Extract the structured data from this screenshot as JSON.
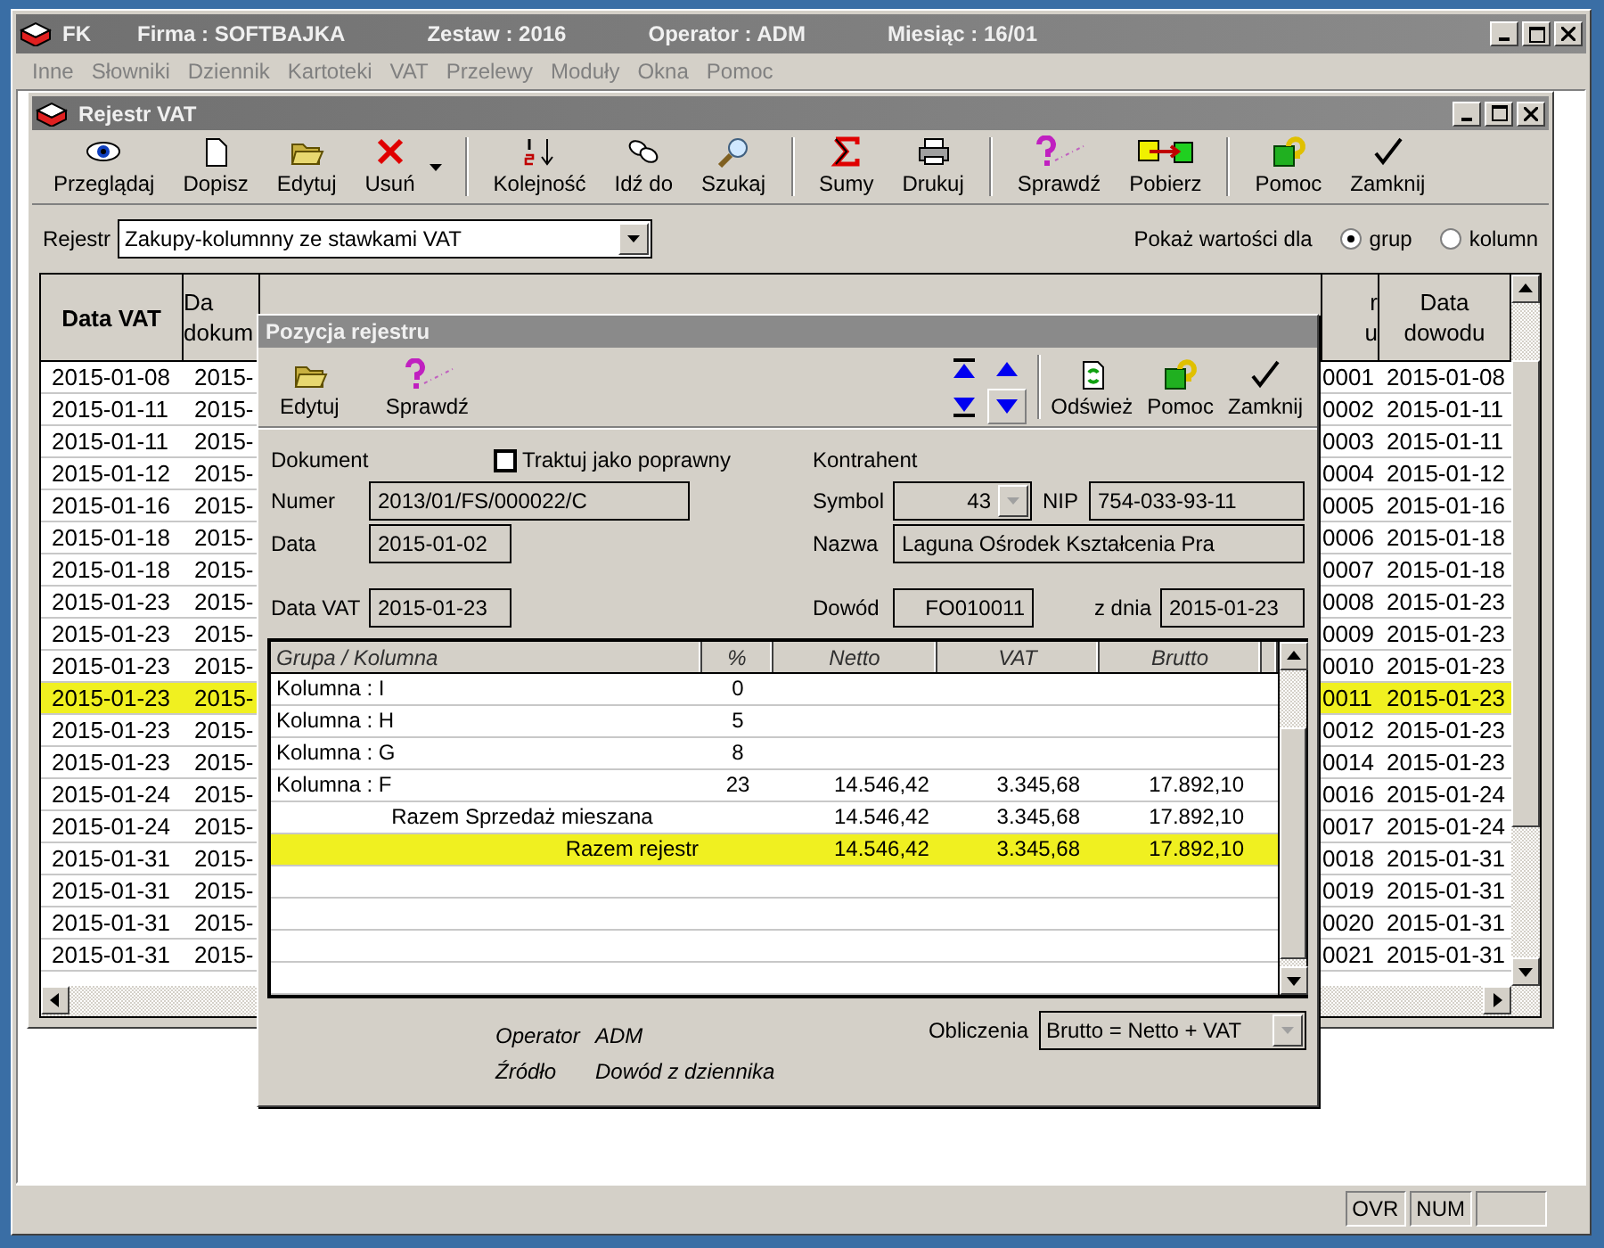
{
  "app": {
    "title": "FK",
    "title_fields": [
      "Firma : SOFTBAJKA",
      "Zestaw : 2016",
      "Operator : ADM",
      "Miesiąc : 16/01"
    ]
  },
  "menu": [
    {
      "label": "Inne",
      "disabled": true
    },
    {
      "label": "Słowniki",
      "disabled": true
    },
    {
      "label": "Dziennik",
      "disabled": true
    },
    {
      "label": "Kartoteki",
      "disabled": true
    },
    {
      "label": "VAT",
      "disabled": true
    },
    {
      "label": "Przelewy",
      "disabled": true
    },
    {
      "label": "Moduły",
      "disabled": true
    },
    {
      "label": "Okna",
      "disabled": true
    },
    {
      "label": "Pomoc",
      "disabled": true
    }
  ],
  "register_window": {
    "title": "Rejestr VAT",
    "toolbar": [
      {
        "kind": "button",
        "label": "Przeglądaj"
      },
      {
        "kind": "button",
        "label": "Dopisz"
      },
      {
        "kind": "button",
        "label": "Edytuj"
      },
      {
        "kind": "button",
        "label": "Usuń"
      },
      {
        "kind": "dropdown"
      },
      {
        "kind": "separator"
      },
      {
        "kind": "button",
        "label": "Kolejność"
      },
      {
        "kind": "button",
        "label": "Idź do"
      },
      {
        "kind": "button",
        "label": "Szukaj"
      },
      {
        "kind": "separator"
      },
      {
        "kind": "button",
        "label": "Sumy"
      },
      {
        "kind": "button",
        "label": "Drukuj"
      },
      {
        "kind": "separator"
      },
      {
        "kind": "button",
        "label": "Sprawdź"
      },
      {
        "kind": "button",
        "label": "Pobierz"
      },
      {
        "kind": "separator"
      },
      {
        "kind": "button",
        "label": "Pomoc"
      },
      {
        "kind": "button",
        "label": "Zamknij"
      }
    ],
    "register": {
      "label": "Rejestr",
      "value": "Zakupy-kolumnny ze stawkami VAT"
    },
    "show_values": {
      "label": "Pokaż wartości dla",
      "options": [
        {
          "label": "grup",
          "selected": true
        },
        {
          "label": "kolumn",
          "selected": false
        }
      ]
    },
    "table": {
      "columns": [
        {
          "lines": [
            "Data VAT"
          ],
          "bold": true
        },
        {
          "lines": [
            "Da",
            "dokum"
          ],
          "bold": false
        },
        {
          "lines": [
            "r",
            "u"
          ],
          "bold": false
        },
        {
          "lines": [
            "Data",
            "dowodu"
          ],
          "bold": false
        }
      ],
      "rows": [
        {
          "cells": [
            "2015-01-08",
            "2015-",
            "0001",
            "2015-01-08"
          ],
          "selected": false
        },
        {
          "cells": [
            "2015-01-11",
            "2015-",
            "0002",
            "2015-01-11"
          ],
          "selected": false
        },
        {
          "cells": [
            "2015-01-11",
            "2015-",
            "0003",
            "2015-01-11"
          ],
          "selected": false
        },
        {
          "cells": [
            "2015-01-12",
            "2015-",
            "0004",
            "2015-01-12"
          ],
          "selected": false
        },
        {
          "cells": [
            "2015-01-16",
            "2015-",
            "0005",
            "2015-01-16"
          ],
          "selected": false
        },
        {
          "cells": [
            "2015-01-18",
            "2015-",
            "0006",
            "2015-01-18"
          ],
          "selected": false
        },
        {
          "cells": [
            "2015-01-18",
            "2015-",
            "0007",
            "2015-01-18"
          ],
          "selected": false
        },
        {
          "cells": [
            "2015-01-23",
            "2015-",
            "0008",
            "2015-01-23"
          ],
          "selected": false
        },
        {
          "cells": [
            "2015-01-23",
            "2015-",
            "0009",
            "2015-01-23"
          ],
          "selected": false
        },
        {
          "cells": [
            "2015-01-23",
            "2015-",
            "0010",
            "2015-01-23"
          ],
          "selected": false
        },
        {
          "cells": [
            "2015-01-23",
            "2015-",
            "0011",
            "2015-01-23"
          ],
          "selected": true
        },
        {
          "cells": [
            "2015-01-23",
            "2015-",
            "0012",
            "2015-01-23"
          ],
          "selected": false
        },
        {
          "cells": [
            "2015-01-23",
            "2015-",
            "0014",
            "2015-01-23"
          ],
          "selected": false
        },
        {
          "cells": [
            "2015-01-24",
            "2015-",
            "0016",
            "2015-01-24"
          ],
          "selected": false
        },
        {
          "cells": [
            "2015-01-24",
            "2015-",
            "0017",
            "2015-01-24"
          ],
          "selected": false
        },
        {
          "cells": [
            "2015-01-31",
            "2015-",
            "0018",
            "2015-01-31"
          ],
          "selected": false
        },
        {
          "cells": [
            "2015-01-31",
            "2015-",
            "0019",
            "2015-01-31"
          ],
          "selected": false
        },
        {
          "cells": [
            "2015-01-31",
            "2015-",
            "0020",
            "2015-01-31"
          ],
          "selected": false
        },
        {
          "cells": [
            "2015-01-31",
            "2015-",
            "0021",
            "2015-01-31"
          ],
          "selected": false
        }
      ]
    }
  },
  "dialog": {
    "title": "Pozycja rejestru",
    "toolbar_left": [
      {
        "label": "Edytuj"
      },
      {
        "label": "Sprawdź"
      }
    ],
    "nav": [
      {
        "kind": "first",
        "pressed": false
      },
      {
        "kind": "prev",
        "pressed": false
      },
      {
        "kind": "last",
        "pressed": false
      },
      {
        "kind": "next",
        "pressed": true
      }
    ],
    "toolbar_right": [
      {
        "label": "Odśwież"
      },
      {
        "label": "Pomoc"
      },
      {
        "label": "Zamknij"
      }
    ],
    "document": {
      "heading": "Dokument",
      "treat_as_valid": {
        "label": "Traktuj jako poprawny",
        "checked": false
      },
      "number": {
        "label": "Numer",
        "value": "2013/01/FS/000022/C"
      },
      "date": {
        "label": "Data",
        "value": "2015-01-02"
      },
      "vat_date": {
        "label": "Data VAT",
        "value": "2015-01-23"
      }
    },
    "contractor": {
      "heading": "Kontrahent",
      "symbol": {
        "label": "Symbol",
        "value": "43"
      },
      "nip": {
        "label": "NIP",
        "value": "754-033-93-11"
      },
      "name": {
        "label": "Nazwa",
        "value": "Laguna Ośrodek Kształcenia Pra"
      },
      "proof": {
        "label": "Dowód",
        "value": "FO010011"
      },
      "proof_date": {
        "label": "z dnia",
        "value": "2015-01-23"
      }
    },
    "groups_table": {
      "columns": [
        "Grupa / Kolumna",
        "%",
        "Netto",
        "VAT",
        "Brutto"
      ],
      "rows": [
        {
          "kind": "column",
          "name": "Kolumna : I",
          "percent": "0",
          "selected": false
        },
        {
          "kind": "column",
          "name": "Kolumna : H",
          "percent": "5",
          "selected": false
        },
        {
          "kind": "column",
          "name": "Kolumna : G",
          "percent": "8",
          "selected": false
        },
        {
          "kind": "column",
          "name": "Kolumna : F",
          "percent": "23",
          "netto": "14.546,42",
          "vat": "3.345,68",
          "brutto": "17.892,10",
          "selected": false
        },
        {
          "kind": "subtotal",
          "name": "Razem Sprzedaż mieszana",
          "netto": "14.546,42",
          "vat": "3.345,68",
          "brutto": "17.892,10",
          "selected": false
        },
        {
          "kind": "total",
          "name": "Razem rejestr",
          "netto": "14.546,42",
          "vat": "3.345,68",
          "brutto": "17.892,10",
          "selected": true
        }
      ]
    },
    "footer": {
      "info": [
        {
          "label": "Operator",
          "value": "ADM"
        },
        {
          "label": "Źródło",
          "value": "Dowód z dziennika"
        }
      ],
      "calculation": {
        "label": "Obliczenia",
        "value": "Brutto = Netto + VAT"
      }
    }
  },
  "status_bar": [
    "OVR",
    "NUM"
  ]
}
